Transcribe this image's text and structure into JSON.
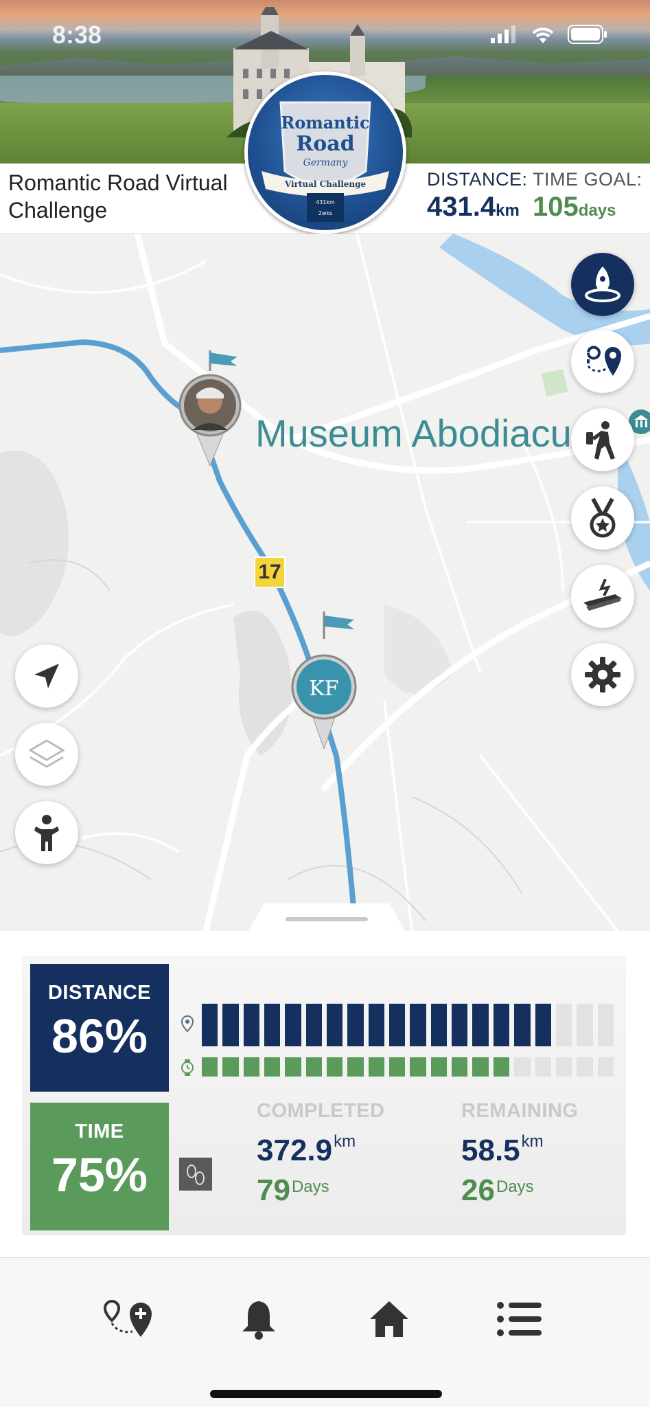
{
  "status_bar": {
    "time": "8:38"
  },
  "header": {
    "challenge_name": "Romantic Road Virtual Challenge",
    "distance_label": "DISTANCE:",
    "distance_value": "431.4",
    "distance_unit": "km",
    "time_goal_label": "TIME GOAL:",
    "time_goal_value": "105",
    "time_goal_unit": "days",
    "logo_text": [
      "Romantic",
      "Road",
      "Germany",
      "Virtual Challenge",
      "431km",
      "2wks"
    ]
  },
  "map": {
    "poi_label": "Museum Abodiacu",
    "route_shield": "17",
    "user_pin_initials": "KF",
    "right_buttons": [
      "rocket-icon",
      "route-pin-icon",
      "hiker-icon",
      "medal-icon",
      "treadmill-icon",
      "gear-icon"
    ],
    "left_buttons": [
      "location-arrow-icon",
      "layers-icon",
      "person-icon"
    ]
  },
  "progress": {
    "distance_label": "DISTANCE",
    "distance_pct": "86%",
    "time_label": "TIME",
    "time_pct": "75%",
    "distance_fraction": 0.86,
    "time_fraction": 0.75,
    "segments": 20,
    "completed_label": "COMPLETED",
    "remaining_label": "REMAINING",
    "completed_km": "372.9",
    "remaining_km": "58.5",
    "km_unit": "km",
    "completed_days": "79",
    "remaining_days": "26",
    "days_unit": "Days"
  },
  "nav": {
    "items": [
      "add-route-icon",
      "bell-icon",
      "home-icon",
      "list-icon"
    ]
  },
  "colors": {
    "navy": "#15305e",
    "green": "#5a9a5b",
    "route_blue": "#5a9fd0"
  }
}
